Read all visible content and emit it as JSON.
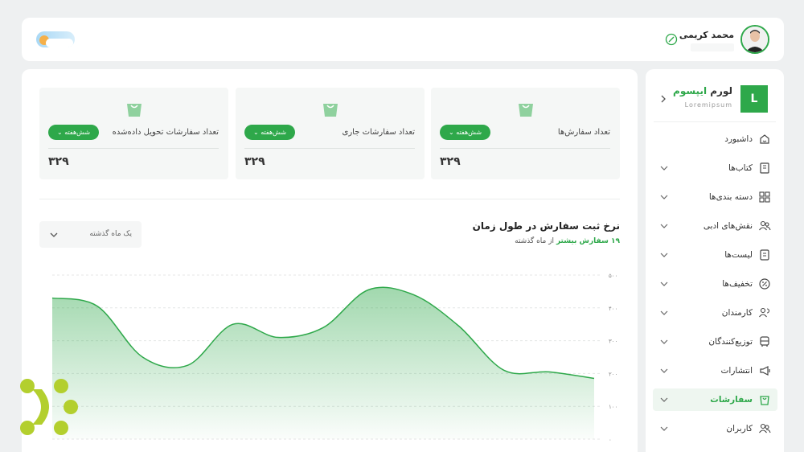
{
  "user": {
    "name": "محمد کریمی"
  },
  "brand": {
    "logo_letter": "L",
    "name_part1": "لورم",
    "name_part2": "ایپسوم",
    "subtitle": "Loremipsum"
  },
  "colors": {
    "accent": "#2ea84a",
    "card_bg": "#f5f7f6"
  },
  "stats": [
    {
      "title": "تعداد سفارش‌ها",
      "period": "شش‌هفته",
      "value": "۳۲۹"
    },
    {
      "title": "تعداد سفارشات جاری",
      "period": "شش‌هفته",
      "value": "۳۲۹"
    },
    {
      "title": "تعداد سفارشات تحویل داده‌شده",
      "period": "شش‌هفته",
      "value": "۳۲۹"
    }
  ],
  "chart": {
    "title": "نرخ ثبت سفارش در طول زمان",
    "subtitle_highlight": "۱۹ سفارش بیشتر",
    "subtitle_rest": "از ماه گذشته",
    "period_select": "یک ماه گذشته"
  },
  "chart_data": {
    "type": "area",
    "y_tick_labels": [
      "۵۰۰",
      "۴۰۰",
      "۳۰۰",
      "۲۰۰",
      "۱۰۰",
      "۰"
    ],
    "y_ticks": [
      500,
      400,
      300,
      200,
      100,
      0
    ],
    "ylim": [
      0,
      500
    ],
    "grid": true,
    "values": [
      430,
      405,
      250,
      225,
      350,
      310,
      340,
      455,
      440,
      345,
      210,
      205,
      185
    ]
  },
  "sidebar": {
    "items": [
      {
        "label": "داشبورد",
        "icon": "dashboard-icon",
        "has_chevron": false,
        "active": false
      },
      {
        "label": "کتاب‌ها",
        "icon": "book-icon",
        "has_chevron": true,
        "active": false
      },
      {
        "label": "دسته بندی‌ها",
        "icon": "grid-icon",
        "has_chevron": true,
        "active": false
      },
      {
        "label": "نقش‌های ادبی",
        "icon": "users-icon",
        "has_chevron": true,
        "active": false
      },
      {
        "label": "لیست‌ها",
        "icon": "list-icon",
        "has_chevron": true,
        "active": false
      },
      {
        "label": "تخفیف‌ها",
        "icon": "discount-icon",
        "has_chevron": true,
        "active": false
      },
      {
        "label": "کارمندان",
        "icon": "employees-icon",
        "has_chevron": true,
        "active": false
      },
      {
        "label": "توزیع‌کنندگان",
        "icon": "bus-icon",
        "has_chevron": true,
        "active": false
      },
      {
        "label": "انتشارات",
        "icon": "megaphone-icon",
        "has_chevron": true,
        "active": false
      },
      {
        "label": "سفارشات",
        "icon": "bag-icon",
        "has_chevron": true,
        "active": true
      },
      {
        "label": "کاربران",
        "icon": "users-icon",
        "has_chevron": true,
        "active": false
      }
    ]
  }
}
